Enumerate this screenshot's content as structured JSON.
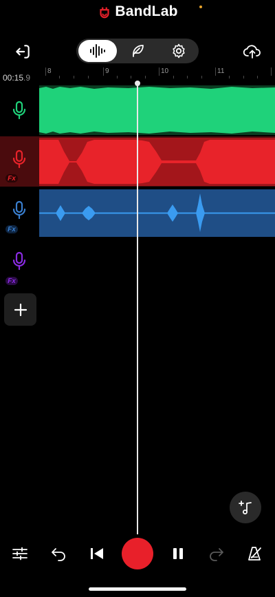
{
  "app": {
    "name": "BandLab",
    "accent_color": "#e8202a"
  },
  "toolbar": {
    "exit_icon": "exit-icon",
    "modes": [
      {
        "icon": "waveform-icon",
        "selected": true
      },
      {
        "icon": "feather-icon",
        "selected": false
      },
      {
        "icon": "gear-icon",
        "selected": false
      }
    ],
    "upload_icon": "cloud-upload-icon"
  },
  "timeline": {
    "time_main": "00:15",
    "time_frac": ".9",
    "bars": [
      "8",
      "9",
      "10",
      "11"
    ]
  },
  "tracks": [
    {
      "name": "track-1",
      "color": "#1fd27a",
      "fx": false,
      "icon": "microphone-icon"
    },
    {
      "name": "track-2",
      "color": "#e8232a",
      "fx": true,
      "fx_label": "Fx",
      "icon": "microphone-icon"
    },
    {
      "name": "track-3",
      "color": "#3a7fcf",
      "fx": true,
      "fx_label": "Fx",
      "icon": "microphone-icon"
    },
    {
      "name": "track-4",
      "color": "#8a2be2",
      "fx": true,
      "fx_label": "Fx",
      "icon": "microphone-icon"
    }
  ],
  "transport": {
    "mixer_icon": "sliders-icon",
    "undo_icon": "undo-icon",
    "rewind_icon": "skip-back-icon",
    "record_icon": "record-icon",
    "pause_icon": "pause-icon",
    "redo_icon": "redo-icon",
    "metronome_icon": "metronome-icon"
  },
  "floating": {
    "add_note_icon": "add-music-note-icon"
  }
}
